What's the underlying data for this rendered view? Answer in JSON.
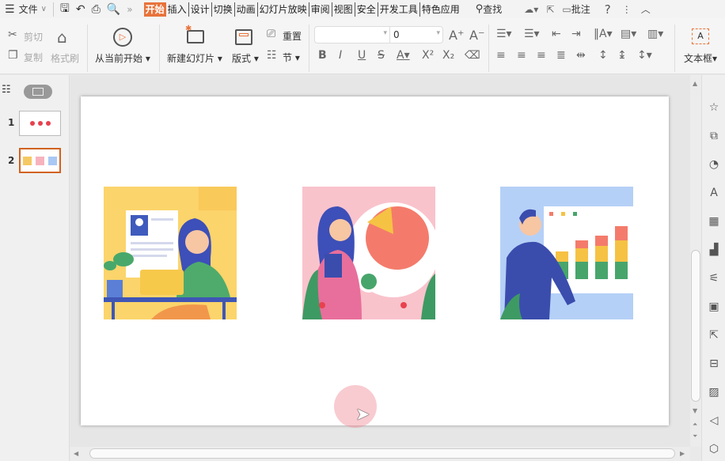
{
  "menubar": {
    "file": "文件",
    "tabs": [
      "开始",
      "插入",
      "设计",
      "切换",
      "动画",
      "幻灯片放映",
      "审阅",
      "视图",
      "安全",
      "开发工具",
      "特色应用"
    ],
    "active_tab": "开始",
    "search": "查找",
    "comment": "批注",
    "help": "?"
  },
  "ribbon": {
    "cut": "剪切",
    "copy": "复制",
    "format_painter": "格式刷",
    "play_from_current": "从当前开始",
    "new_slide": "新建幻灯片",
    "layout": "版式",
    "reset": "重置",
    "section": "节",
    "font_name": "",
    "font_size": "0",
    "textbox": "文本框"
  },
  "slides_panel": {
    "slides": [
      {
        "number": "1"
      },
      {
        "number": "2"
      }
    ],
    "selected": 2
  },
  "slide": {
    "images": [
      "woman-at-laptop-illustration",
      "woman-with-pie-chart-illustration",
      "man-presenting-bar-chart-illustration"
    ]
  },
  "colors": {
    "accent": "#e8733a",
    "selected_border": "#d0621f"
  }
}
